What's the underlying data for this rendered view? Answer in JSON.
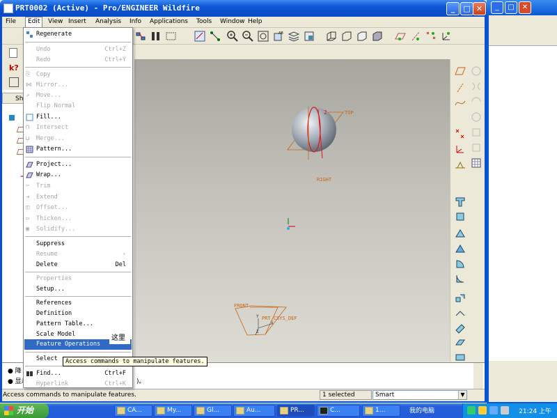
{
  "window": {
    "title": "PRT0002 (Active) - Pro/ENGINEER Wildfire",
    "minimize": "_",
    "maximize": "□",
    "close": "✕"
  },
  "menubar": [
    {
      "label": "File"
    },
    {
      "label": "Edit"
    },
    {
      "label": "View"
    },
    {
      "label": "Insert"
    },
    {
      "label": "Analysis"
    },
    {
      "label": "Info"
    },
    {
      "label": "Applications"
    },
    {
      "label": "Tools"
    },
    {
      "label": "Window"
    },
    {
      "label": "Help"
    }
  ],
  "edit_menu": {
    "regenerate": "Regenerate",
    "undo": "Undo",
    "undo_acc": "Ctrl+Z",
    "redo": "Redo",
    "redo_acc": "Ctrl+Y",
    "copy": "Copy",
    "mirror": "Mirror...",
    "move": "Move...",
    "flip_normal": "Flip Normal",
    "fill": "Fill...",
    "intersect": "Intersect",
    "merge": "Merge...",
    "pattern": "Pattern...",
    "project": "Project...",
    "wrap": "Wrap...",
    "trim": "Trim",
    "extend": "Extend",
    "offset": "Offset...",
    "thicken": "Thicken...",
    "solidify": "Solidify...",
    "suppress": "Suppress",
    "resume": "Resume",
    "delete": "Delete",
    "delete_acc": "Del",
    "properties": "Properties",
    "setup": "Setup...",
    "references": "References",
    "definition": "Definition",
    "pattern_table": "Pattern Table...",
    "scale_model": "Scale Model",
    "feature_operations": "Feature Operations",
    "select": "Select",
    "find": "Find...",
    "find_acc": "Ctrl+F",
    "hyperlink": "Hyperlink",
    "hyperlink_acc": "Ctrl+K"
  },
  "tooltip": "Access commands to manipulate features.",
  "chinese_popup": "这里",
  "datum_labels": {
    "top": "TOP",
    "right": "RIGHT",
    "front": "FRONT",
    "csys": "PRT_CSYS_DEF",
    "dim": "2",
    "y": "Y",
    "x": "X",
    "z": "Z"
  },
  "left_panel": {
    "show_tab": "Sho"
  },
  "message_area": {
    "line1": "降",
    "line2": "显示",
    "line2_tail": ")。"
  },
  "statusbar": {
    "text": "Access commands to manipulate features.",
    "selected": "1 selected",
    "filter": "Smart"
  },
  "taskbar": {
    "start": "开始",
    "tasks": [
      {
        "label": "CA..."
      },
      {
        "label": "My..."
      },
      {
        "label": "Gl..."
      },
      {
        "label": "Au..."
      },
      {
        "label": "PR..."
      },
      {
        "label": "C..."
      },
      {
        "label": "1..."
      }
    ],
    "ime": "我的电脑",
    "clock": "21:24 上午"
  },
  "colors": {
    "title_blue": "#0a4fd0",
    "menu_highlight": "#316ac5",
    "datum_orange": "#c86414",
    "sphere": "#a8aeb6"
  }
}
